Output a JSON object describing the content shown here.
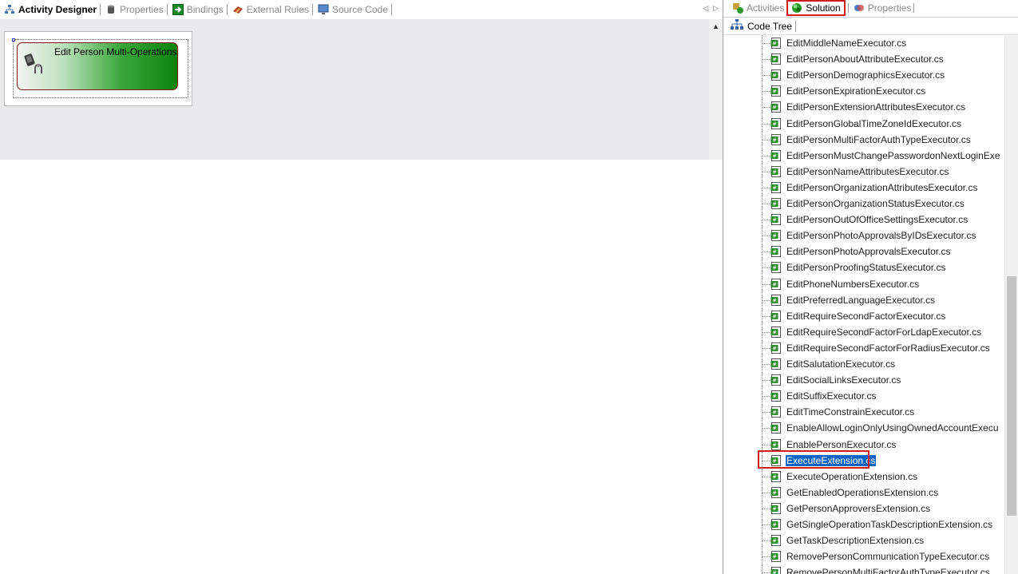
{
  "left_tabs": [
    {
      "label": "Activity Designer",
      "icon": "workflow-icon",
      "active": true
    },
    {
      "label": "Properties",
      "icon": "database-icon",
      "active": false
    },
    {
      "label": "Bindings",
      "icon": "green-arrow-icon",
      "active": false
    },
    {
      "label": "External Rules",
      "icon": "rules-icon",
      "active": false
    },
    {
      "label": "Source Code",
      "icon": "monitor-icon",
      "active": false
    }
  ],
  "activity": {
    "label": "Edit Person Multi-Operations",
    "icon": "activity-person-icon"
  },
  "right_tabs": [
    {
      "label": "Activities",
      "icon": "activities-icon",
      "active": false
    },
    {
      "label": "Solution",
      "icon": "solution-icon",
      "active": true
    },
    {
      "label": "Properties",
      "icon": "properties-icon",
      "active": false
    }
  ],
  "code_tree": {
    "tab_label": "Code Tree",
    "selected": "ExecuteExtension.cs",
    "files": [
      "EditMiddleNameExecutor.cs",
      "EditPersonAboutAttributeExecutor.cs",
      "EditPersonDemographicsExecutor.cs",
      "EditPersonExpirationExecutor.cs",
      "EditPersonExtensionAttributesExecutor.cs",
      "EditPersonGlobalTimeZoneIdExecutor.cs",
      "EditPersonMultiFactorAuthTypeExecutor.cs",
      "EditPersonMustChangePasswordonNextLoginExe",
      "EditPersonNameAttributesExecutor.cs",
      "EditPersonOrganizationAttributesExecutor.cs",
      "EditPersonOrganizationStatusExecutor.cs",
      "EditPersonOutOfOfficeSettingsExecutor.cs",
      "EditPersonPhotoApprovalsByIDsExecutor.cs",
      "EditPersonPhotoApprovalsExecutor.cs",
      "EditPersonProofingStatusExecutor.cs",
      "EditPhoneNumbersExecutor.cs",
      "EditPreferredLanguageExecutor.cs",
      "EditRequireSecondFactorExecutor.cs",
      "EditRequireSecondFactorForLdapExecutor.cs",
      "EditRequireSecondFactorForRadiusExecutor.cs",
      "EditSalutationExecutor.cs",
      "EditSocialLinksExecutor.cs",
      "EditSuffixExecutor.cs",
      "EditTimeConstrainExecutor.cs",
      "EnableAllowLoginOnlyUsingOwnedAccountExecu",
      "EnablePersonExecutor.cs",
      "ExecuteExtension.cs",
      "ExecuteOperationExtension.cs",
      "GetEnabledOperationsExtension.cs",
      "GetPersonApproversExtension.cs",
      "GetSingleOperationTaskDescriptionExtension.cs",
      "GetTaskDescriptionExtension.cs",
      "RemovePersonCommunicationTypeExecutor.cs",
      "RemovePersonMultiFactorAuthTypeExecutor.cs"
    ]
  }
}
